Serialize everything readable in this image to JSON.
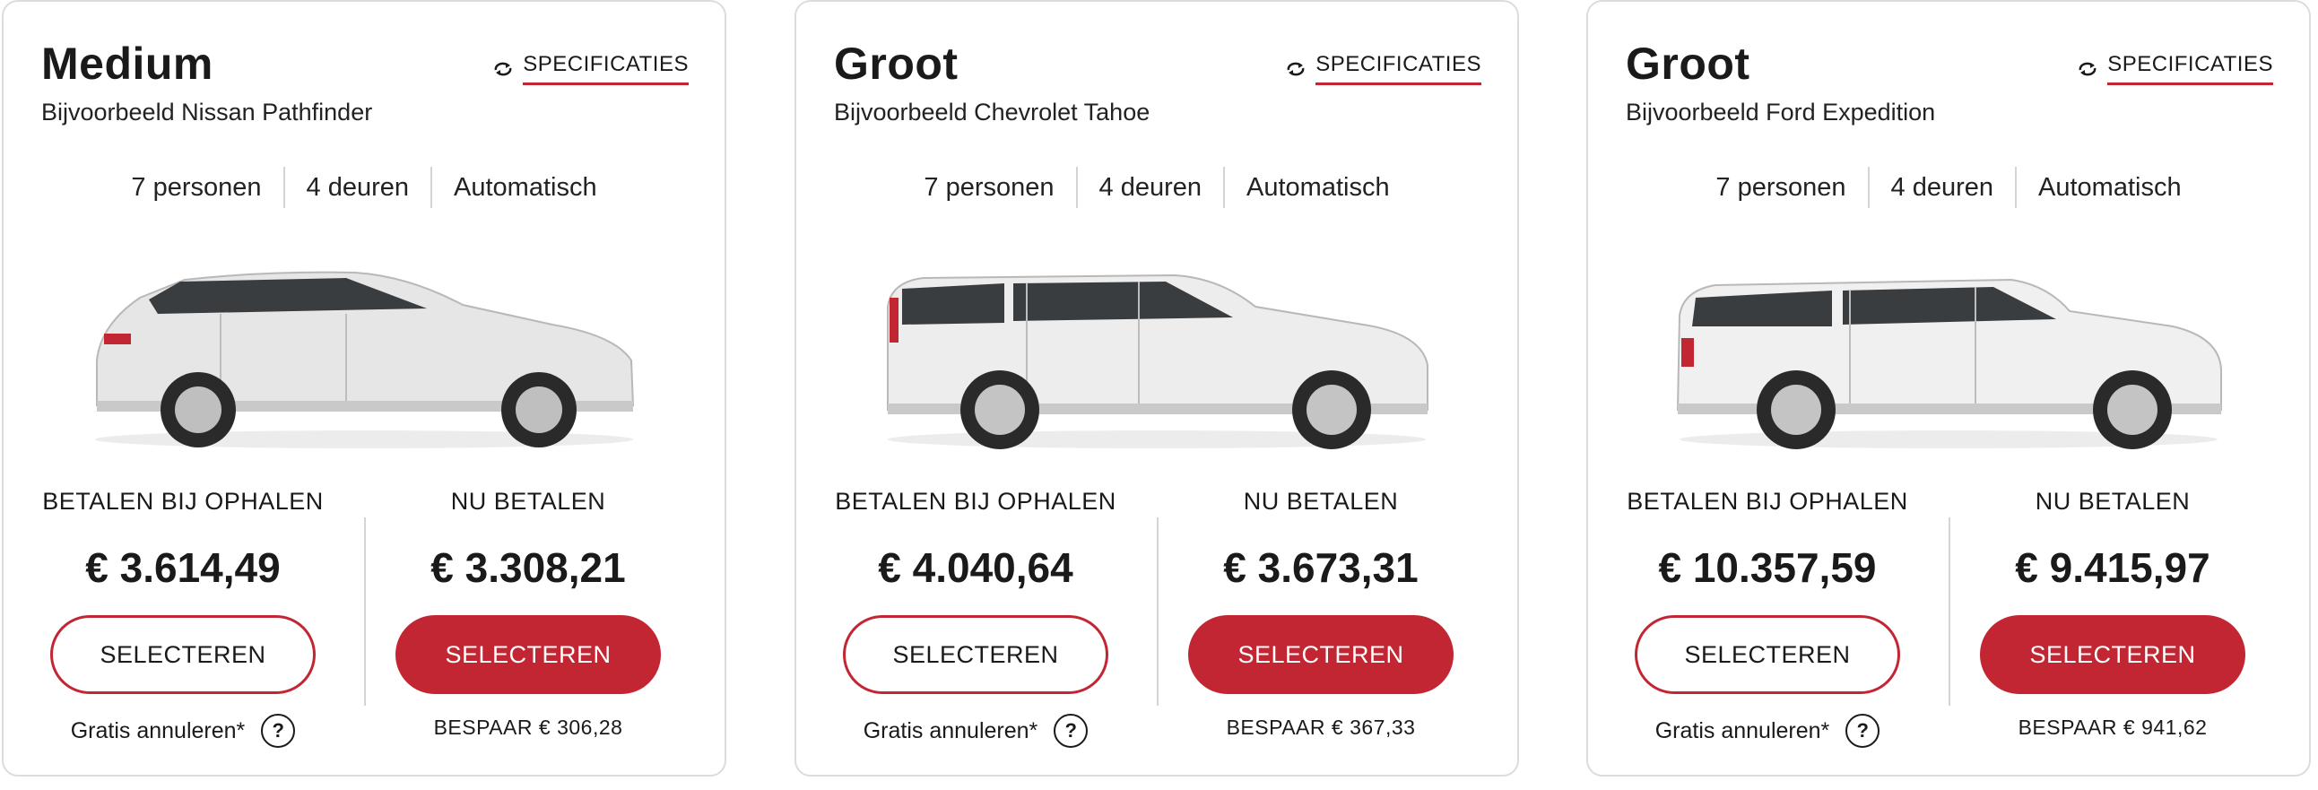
{
  "cards": [
    {
      "title": "Medium",
      "example": "Bijvoorbeeld Nissan Pathfinder",
      "spec_label": "SPECIFICATIES",
      "features": [
        "7 personen",
        "4 deuren",
        "Automatisch"
      ],
      "pay_later": {
        "heading": "BETALEN BIJ OPHALEN",
        "price": "€ 3.614,49",
        "button": "SELECTEREN",
        "cancel_text": "Gratis annuleren*",
        "help_glyph": "?"
      },
      "pay_now": {
        "heading": "NU BETALEN",
        "price": "€ 3.308,21",
        "button": "SELECTEREN",
        "savings": "BESPAAR € 306,28"
      }
    },
    {
      "title": "Groot",
      "example": "Bijvoorbeeld Chevrolet Tahoe",
      "spec_label": "SPECIFICATIES",
      "features": [
        "7 personen",
        "4 deuren",
        "Automatisch"
      ],
      "pay_later": {
        "heading": "BETALEN BIJ OPHALEN",
        "price": "€ 4.040,64",
        "button": "SELECTEREN",
        "cancel_text": "Gratis annuleren*",
        "help_glyph": "?"
      },
      "pay_now": {
        "heading": "NU BETALEN",
        "price": "€ 3.673,31",
        "button": "SELECTEREN",
        "savings": "BESPAAR € 367,33"
      }
    },
    {
      "title": "Groot",
      "example": "Bijvoorbeeld Ford Expedition",
      "spec_label": "SPECIFICATIES",
      "features": [
        "7 personen",
        "4 deuren",
        "Automatisch"
      ],
      "pay_later": {
        "heading": "BETALEN BIJ OPHALEN",
        "price": "€ 10.357,59",
        "button": "SELECTEREN",
        "cancel_text": "Gratis annuleren*",
        "help_glyph": "?"
      },
      "pay_now": {
        "heading": "NU BETALEN",
        "price": "€ 9.415,97",
        "button": "SELECTEREN",
        "savings": "BESPAAR € 941,62"
      }
    }
  ],
  "colors": {
    "accent": "#c32633",
    "border": "#dcdcdc",
    "divider": "#d4d4d4",
    "text": "#1a1a1a",
    "car_body": "#e6e6e6"
  },
  "icons": {
    "spec": "rotate-arrows-icon",
    "help": "question-circle-icon",
    "car": "suv-side-view-icon"
  }
}
